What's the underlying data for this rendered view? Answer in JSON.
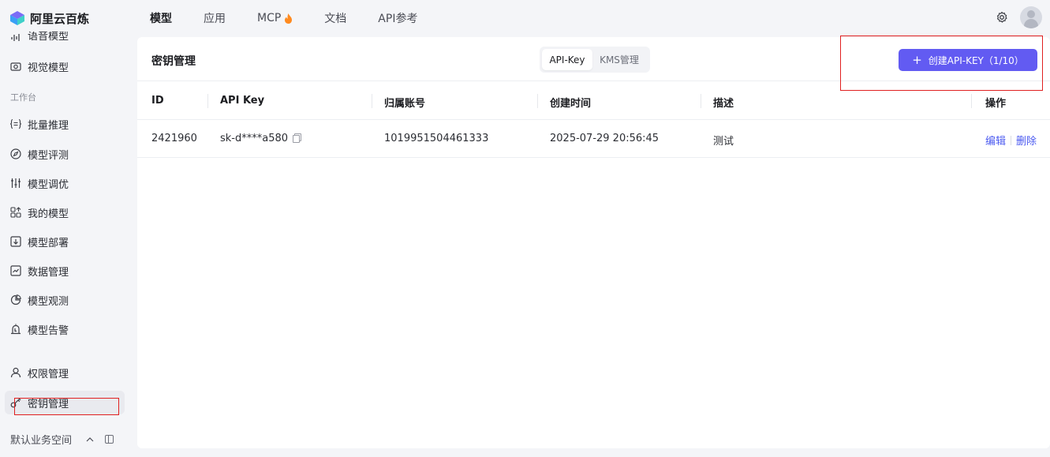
{
  "brand": {
    "name": "阿里云百炼"
  },
  "nav": {
    "items": [
      {
        "label": "模型",
        "active": true
      },
      {
        "label": "应用",
        "active": false
      },
      {
        "label": "MCP",
        "active": false,
        "badge_icon": "fire-icon"
      },
      {
        "label": "文档",
        "active": false
      },
      {
        "label": "API参考",
        "active": false
      }
    ]
  },
  "sidebar": {
    "cut_item": "语音模型",
    "vision_model": "视觉模型",
    "group_workbench": "工作台",
    "items": [
      {
        "label": "批量推理",
        "icon": "batch-icon"
      },
      {
        "label": "模型评测",
        "icon": "compass-icon"
      },
      {
        "label": "模型调优",
        "icon": "tune-icon"
      },
      {
        "label": "我的模型",
        "icon": "grid-icon"
      },
      {
        "label": "模型部署",
        "icon": "deploy-icon"
      },
      {
        "label": "数据管理",
        "icon": "chart-icon"
      },
      {
        "label": "模型观测",
        "icon": "pie-icon"
      },
      {
        "label": "模型告警",
        "icon": "alarm-icon"
      }
    ],
    "permission": "权限管理",
    "key_mgmt": "密钥管理",
    "workspace": "默认业务空间"
  },
  "main": {
    "title": "密钥管理",
    "tabs": [
      "API-Key",
      "KMS管理"
    ],
    "create_label": "创建API-KEY（1/10）",
    "table": {
      "headers": [
        "ID",
        "API Key",
        "归属账号",
        "创建时间",
        "描述",
        "操作"
      ],
      "rows": [
        {
          "id": "2421960",
          "api_key": "sk-d****a580",
          "account": "1019951504461333",
          "created": "2025-07-29 20:56:45",
          "desc": "测试",
          "edit": "编辑",
          "delete": "删除"
        }
      ]
    }
  },
  "colors": {
    "primary": "#625bf2",
    "link": "#4b5af0",
    "annotation": "#e02020"
  }
}
